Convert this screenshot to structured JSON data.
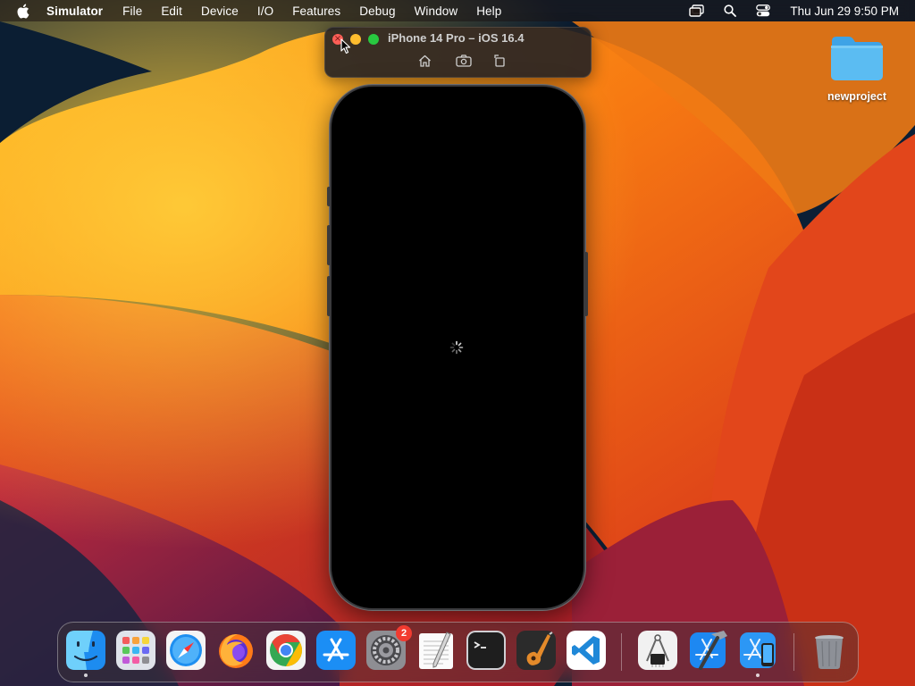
{
  "menubar": {
    "app_name": "Simulator",
    "items": [
      "File",
      "Edit",
      "Device",
      "I/O",
      "Features",
      "Debug",
      "Window",
      "Help"
    ],
    "clock": "Thu Jun 29  9:50 PM",
    "status_icons": [
      "screen-mirroring-icon",
      "spotlight-search-icon",
      "control-center-icon"
    ]
  },
  "simulator": {
    "title": "iPhone 14 Pro – iOS 16.4",
    "toolbar_buttons": [
      "home-icon",
      "screenshot-icon",
      "rotate-icon"
    ],
    "screen_state": "loading"
  },
  "desktop": {
    "folder_label": "newproject"
  },
  "dock": {
    "apps": [
      {
        "name": "finder-icon",
        "running": true
      },
      {
        "name": "launchpad-icon",
        "running": false
      },
      {
        "name": "safari-icon",
        "running": false
      },
      {
        "name": "firefox-icon",
        "running": false
      },
      {
        "name": "chrome-icon",
        "running": false
      },
      {
        "name": "app-store-icon",
        "running": false
      },
      {
        "name": "system-settings-icon",
        "running": false,
        "badge": "2"
      },
      {
        "name": "textedit-icon",
        "running": false
      },
      {
        "name": "terminal-icon",
        "running": false
      },
      {
        "name": "garageband-icon",
        "running": false
      },
      {
        "name": "vscode-icon",
        "running": false
      },
      {
        "name": "system-information-icon",
        "running": false
      },
      {
        "name": "xcode-icon",
        "running": false
      },
      {
        "name": "simulator-icon",
        "running": true
      },
      {
        "name": "trash-icon",
        "running": false
      }
    ]
  },
  "colors": {
    "wallpaper_orange": "#f77a12",
    "wallpaper_navy": "#0b1e33",
    "close": "#ff5f57",
    "minimize": "#febc2e",
    "zoom": "#28c840",
    "badge": "#f23b30"
  }
}
